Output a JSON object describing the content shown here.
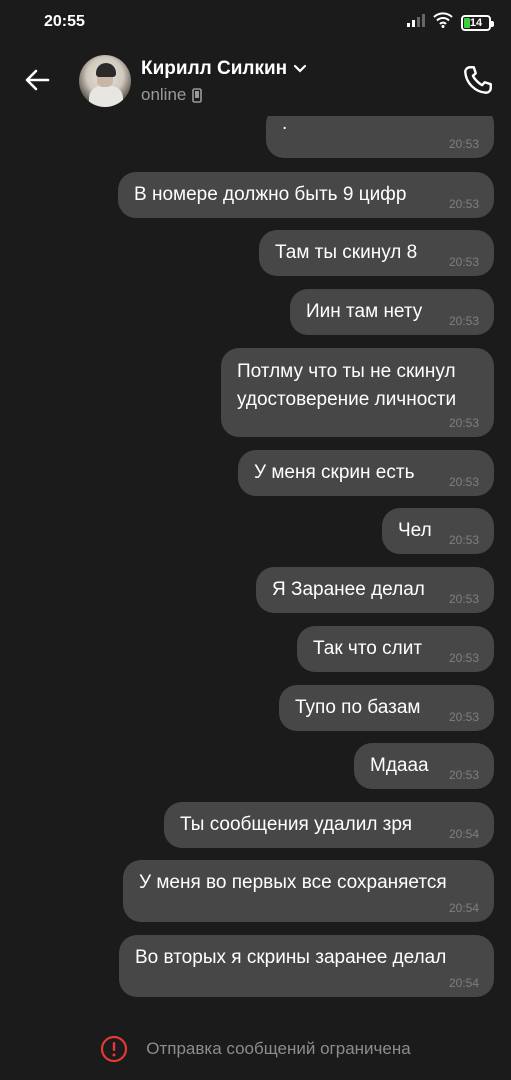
{
  "status_bar": {
    "time": "20:55",
    "battery": "14",
    "icons": [
      "signal-icon",
      "wifi-icon",
      "battery-icon"
    ]
  },
  "header": {
    "contact_name": "Кирилл Силкин",
    "status": "online",
    "icons": [
      "back-arrow-icon",
      "chevron-down-icon",
      "mobile-device-icon",
      "phone-icon"
    ]
  },
  "messages": [
    {
      "text": ".",
      "time": "20:53"
    },
    {
      "text": "В номере должно быть 9 цифр",
      "time": "20:53"
    },
    {
      "text": "Там ты скинул 8",
      "time": "20:53"
    },
    {
      "text": "Иин там нету",
      "time": "20:53"
    },
    {
      "text": "Потлму что ты не скинул\nудостоверение личности",
      "time": "20:53"
    },
    {
      "text": "У меня скрин есть",
      "time": "20:53"
    },
    {
      "text": "Чел",
      "time": "20:53"
    },
    {
      "text": "Я Заранее делал",
      "time": "20:53"
    },
    {
      "text": "Так что слит",
      "time": "20:53"
    },
    {
      "text": "Тупо по базам",
      "time": "20:53"
    },
    {
      "text": "Мдааа",
      "time": "20:53"
    },
    {
      "text": "Ты сообщения удалил зря",
      "time": "20:54"
    },
    {
      "text": "У меня во первых все сохраняется",
      "time": "20:54"
    },
    {
      "text": "Во вторых я скрины заранее делал",
      "time": "20:54"
    }
  ],
  "footer": {
    "notice": "Отправка сообщений ограничена",
    "icon": "alert-circle-icon",
    "icon_color": "#e53935"
  },
  "colors": {
    "background": "#1b1b1b",
    "bubble": "#474747",
    "timestamp": "#7f7f7f",
    "secondary_text": "#9a9a9a"
  }
}
